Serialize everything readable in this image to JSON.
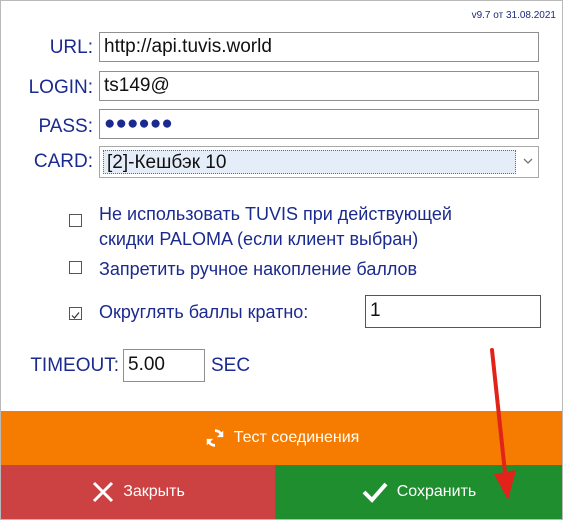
{
  "version": "v9.7 от 31.08.2021",
  "fields": {
    "url": {
      "label": "URL:",
      "value": "http://api.tuvis.world"
    },
    "login": {
      "label": "LOGIN:",
      "value": "ts149@"
    },
    "pass": {
      "label": "PASS:",
      "value": "●●●●●●"
    },
    "card": {
      "label": "CARD:",
      "value": "[2]-Кешбэк 10"
    }
  },
  "options": {
    "no_tuvis": {
      "checked": false,
      "line1": "Не использовать TUVIS при действующей",
      "line2": "скидки PALOMA (если клиент выбран)"
    },
    "no_manual": {
      "checked": false,
      "text": "Запретить ручное накопление баллов"
    },
    "round": {
      "checked": true,
      "text": "Округлять баллы кратно:",
      "value": "1"
    }
  },
  "timeout": {
    "label": "TIMEOUT:",
    "value": "5.00",
    "unit": "SEC"
  },
  "buttons": {
    "test": "Тест соединения",
    "close": "Закрыть",
    "save": "Сохранить"
  },
  "colors": {
    "test": "#f57c00",
    "close": "#cc4141",
    "save": "#1e8e2f",
    "label": "#1b2a8f",
    "annotation_arrow": "#e2231a"
  },
  "icons": {
    "test": "refresh-icon",
    "close": "close-icon",
    "save": "checkmark-icon",
    "select": "chevron-down-icon"
  }
}
